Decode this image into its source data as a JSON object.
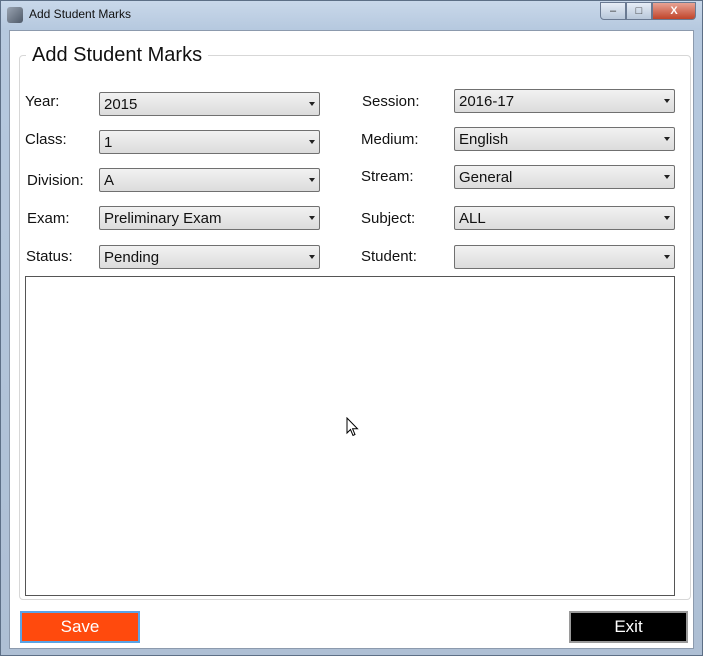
{
  "window": {
    "title": "Add Student Marks",
    "caption_buttons": {
      "minimize": "–",
      "maximize": "□",
      "close": "X"
    }
  },
  "form": {
    "legend": "Add Student Marks",
    "left": [
      {
        "label": "Year:",
        "value": "2015"
      },
      {
        "label": "Class:",
        "value": "1"
      },
      {
        "label": "Division:",
        "value": "A"
      },
      {
        "label": "Exam:",
        "value": "Preliminary Exam"
      },
      {
        "label": "Status:",
        "value": "Pending"
      }
    ],
    "right": [
      {
        "label": "Session:",
        "value": "2016-17"
      },
      {
        "label": "Medium:",
        "value": "English"
      },
      {
        "label": "Stream:",
        "value": "General"
      },
      {
        "label": "Subject:",
        "value": "ALL"
      },
      {
        "label": "Student:",
        "value": ""
      }
    ]
  },
  "buttons": {
    "save": "Save",
    "exit": "Exit"
  },
  "colors": {
    "save_bg": "#ff4a0d",
    "exit_bg": "#000000"
  },
  "icons": {
    "app": "app-icon",
    "cursor": "mouse-pointer-icon",
    "dropdown": "chevron-down-icon"
  }
}
